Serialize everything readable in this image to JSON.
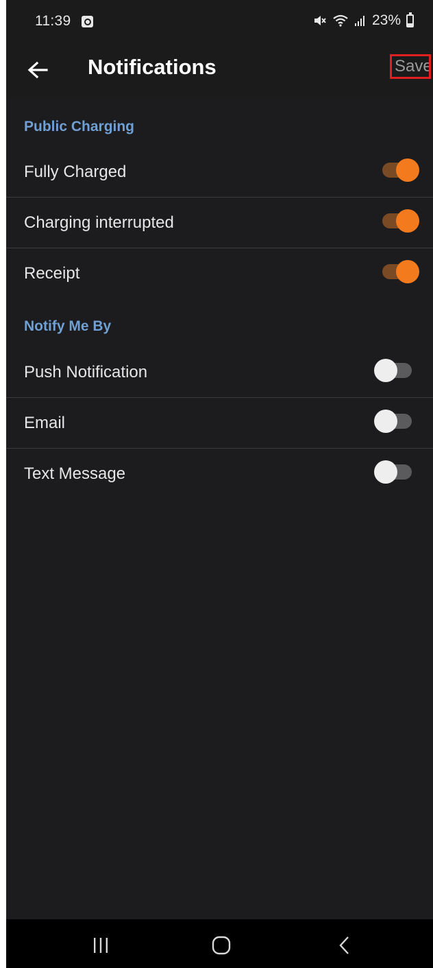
{
  "status_bar": {
    "time": "11:39",
    "battery_percent": "23%",
    "battery_level": 0.23,
    "icons": [
      "notification-app-icon",
      "mute-icon",
      "wifi-icon",
      "signal-icon",
      "battery-icon"
    ]
  },
  "app_bar": {
    "back_icon": "arrow-left-icon",
    "title": "Notifications",
    "save_label": "Save"
  },
  "sections": {
    "public_charging": {
      "header": "Public Charging",
      "items": [
        {
          "label": "Fully Charged",
          "enabled": true
        },
        {
          "label": "Charging interrupted",
          "enabled": true
        },
        {
          "label": "Receipt",
          "enabled": true
        }
      ]
    },
    "notify_me_by": {
      "header": "Notify Me By",
      "items": [
        {
          "label": "Push Notification",
          "enabled": false
        },
        {
          "label": "Email",
          "enabled": false
        },
        {
          "label": "Text Message",
          "enabled": false
        }
      ]
    }
  },
  "nav_bar": {
    "icons": [
      "recent-apps-icon",
      "home-icon",
      "back-icon"
    ]
  },
  "colors": {
    "background": "#1c1c1e",
    "section_header": "#6f9fd3",
    "toggle_on": "#f47b1d",
    "toggle_off_knob": "#eeeeee",
    "save_highlight": "#e0201f"
  }
}
